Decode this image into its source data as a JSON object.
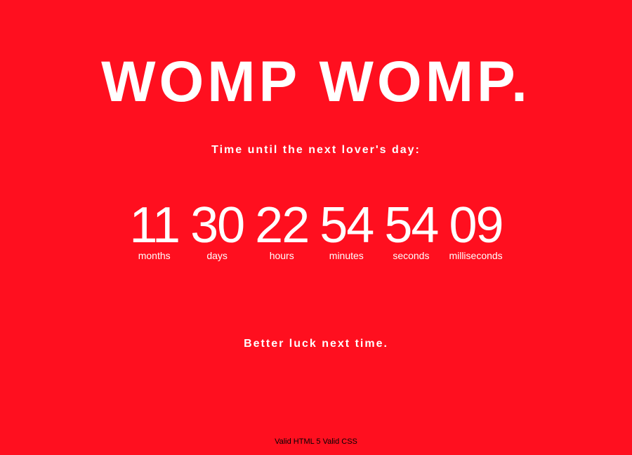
{
  "headline": "WOMP WOMP.",
  "subtitle": "Time until the next lover's day:",
  "countdown": [
    {
      "value": "11",
      "label": "months"
    },
    {
      "value": "30",
      "label": "days"
    },
    {
      "value": "22",
      "label": "hours"
    },
    {
      "value": "54",
      "label": "minutes"
    },
    {
      "value": "54",
      "label": "seconds"
    },
    {
      "value": "09",
      "label": "milliseconds"
    }
  ],
  "message": "Better luck next time.",
  "footer": {
    "html_link": "Valid HTML 5",
    "css_link": "Valid CSS"
  },
  "colors": {
    "background": "#ff0f1f",
    "text": "#ffffff",
    "footer_text": "#000000"
  }
}
